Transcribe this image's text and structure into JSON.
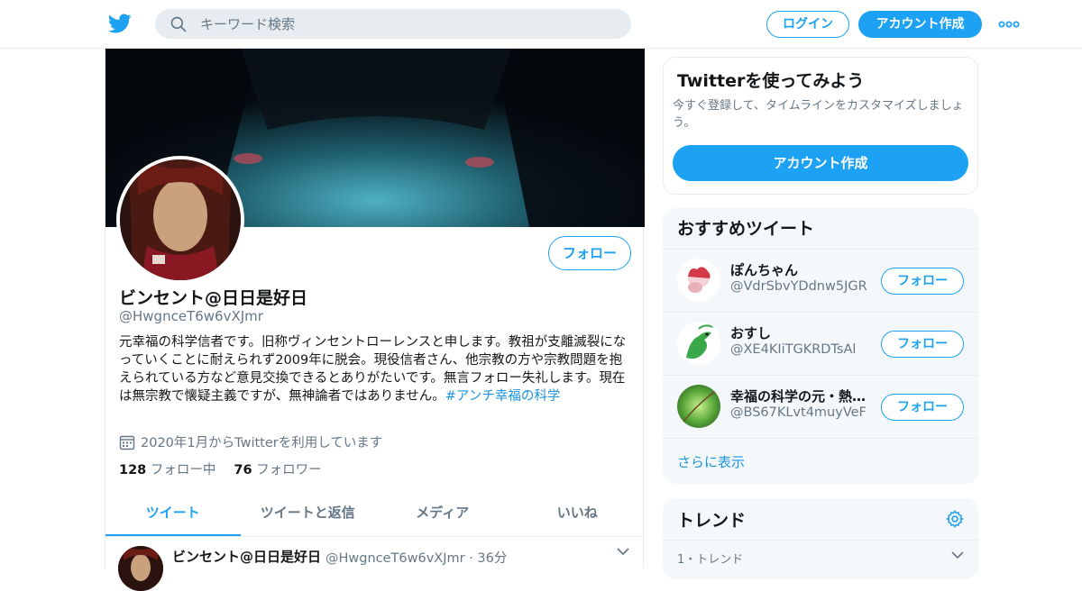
{
  "header": {
    "search_placeholder": "キーワード検索",
    "login_label": "ログイン",
    "signup_label": "アカウント作成"
  },
  "profile": {
    "display_name": "ビンセント@日日是好日",
    "handle": "@HwgnceT6w6vXJmr",
    "follow_label": "フォロー",
    "bio_text": "元幸福の科学信者です。旧称ヴィンセントローレンスと申します。教祖が支離滅裂になっていくことに耐えられず2009年に脱会。現役信者さん、他宗教の方や宗教問題を抱えられている方など意見交換できるとありがたいです。無言フォロー失礼します。現在は無宗教で懐疑主義ですが、無神論者ではありません。",
    "bio_hashtag": "#アンチ幸福の科学",
    "joined": "2020年1月からTwitterを利用しています",
    "following_count": "128",
    "following_label": "フォロー中",
    "followers_count": "76",
    "followers_label": "フォロワー"
  },
  "tabs": [
    {
      "label": "ツイート",
      "active": true
    },
    {
      "label": "ツイートと返信",
      "active": false
    },
    {
      "label": "メディア",
      "active": false
    },
    {
      "label": "いいね",
      "active": false
    }
  ],
  "tweet": {
    "name": "ビンセント@日日是好日",
    "meta": "@HwgnceT6w6vXJmr · 36分"
  },
  "signup_card": {
    "title": "Twitterを使ってみよう",
    "description": "今すぐ登録して、タイムラインをカスタマイズしましょう。",
    "button_label": "アカウント作成"
  },
  "recommended": {
    "title": "おすすめツイート",
    "users": [
      {
        "name": "ぽんちゃん",
        "handle": "@VdrSbvYDdnw5JGR",
        "follow_label": "フォロー"
      },
      {
        "name": "おすし",
        "handle": "@XE4KIiTGKRDTsAl",
        "follow_label": "フォロー"
      },
      {
        "name": "幸福の科学の元・熱心な信者です",
        "handle": "@BS67KLvt4muyVeF",
        "follow_label": "フォロー"
      }
    ],
    "more_label": "さらに表示"
  },
  "trends": {
    "title": "トレンド",
    "sub": "1・トレンド"
  },
  "colors": {
    "brand": "#1da1f2",
    "link": "#1b95e0",
    "muted": "#657786"
  }
}
